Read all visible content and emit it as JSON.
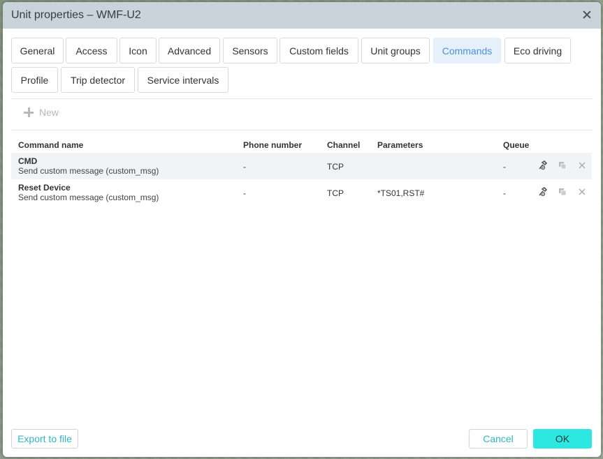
{
  "dialog": {
    "title": "Unit properties – WMF-U2"
  },
  "tabs": [
    {
      "label": "General"
    },
    {
      "label": "Access"
    },
    {
      "label": "Icon"
    },
    {
      "label": "Advanced"
    },
    {
      "label": "Sensors"
    },
    {
      "label": "Custom fields"
    },
    {
      "label": "Unit groups"
    },
    {
      "label": "Commands",
      "active": true
    },
    {
      "label": "Eco driving"
    },
    {
      "label": "Profile"
    },
    {
      "label": "Trip detector"
    },
    {
      "label": "Service intervals"
    }
  ],
  "toolbar": {
    "new_label": "New"
  },
  "table": {
    "headers": {
      "command_name": "Command name",
      "phone": "Phone number",
      "channel": "Channel",
      "parameters": "Parameters",
      "queue": "Queue"
    },
    "rows": [
      {
        "name": "CMD",
        "description": "Send custom message (custom_msg)",
        "phone": "-",
        "channel": "TCP",
        "parameters": "",
        "queue": "-"
      },
      {
        "name": "Reset Device",
        "description": "Send custom message (custom_msg)",
        "phone": "-",
        "channel": "TCP",
        "parameters": "*TS01,RST#",
        "queue": "-"
      }
    ]
  },
  "footer": {
    "export_label": "Export to file",
    "cancel_label": "Cancel",
    "ok_label": "OK"
  },
  "colors": {
    "accent": "#2fb4c2",
    "ok_button": "#2de8e0",
    "active_tab_text": "#4a90e2",
    "active_tab_bg": "#e6f0fb",
    "titlebar_bg": "#c9d3da"
  },
  "icons": {
    "row_actions": [
      "send-command-icon",
      "copy-icon",
      "delete-icon"
    ]
  }
}
